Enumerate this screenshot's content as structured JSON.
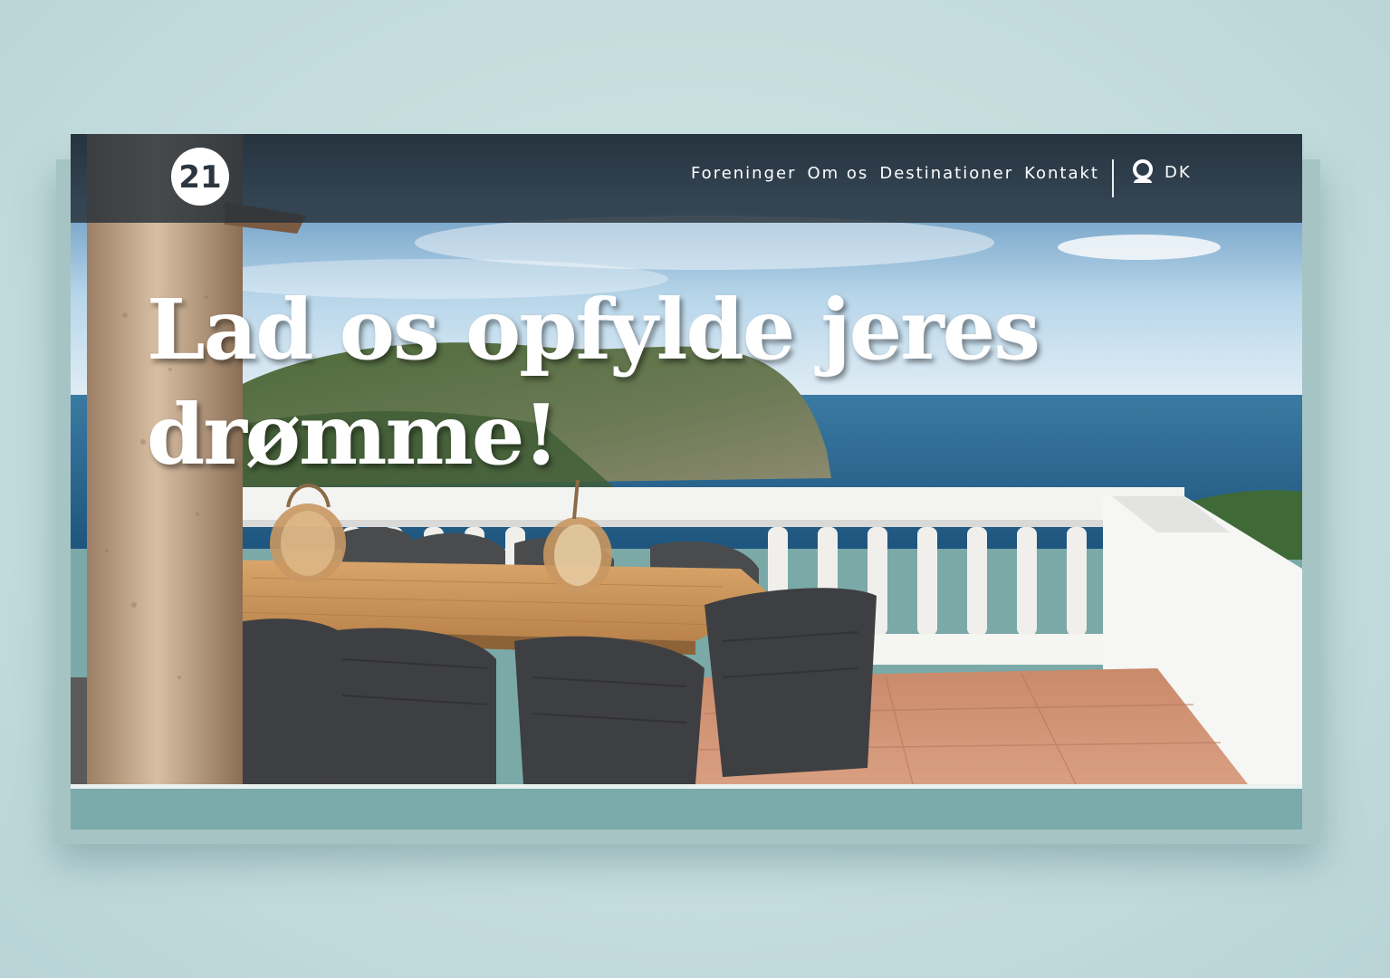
{
  "header": {
    "logo_label": "21",
    "nav": [
      {
        "label": "Foreninger"
      },
      {
        "label": "Om os"
      },
      {
        "label": "Destinationer"
      },
      {
        "label": "Kontakt"
      }
    ],
    "language": "DK"
  },
  "hero": {
    "headline": "Lad os opfylde jeres drømme!"
  },
  "icons": {
    "logo": "21-circle-logo",
    "account": "user-icon"
  },
  "colors": {
    "navbar": "#263038",
    "accent_teal": "#7aabaa",
    "sea": "#2f6f95",
    "sky": "#7fb2d6"
  }
}
